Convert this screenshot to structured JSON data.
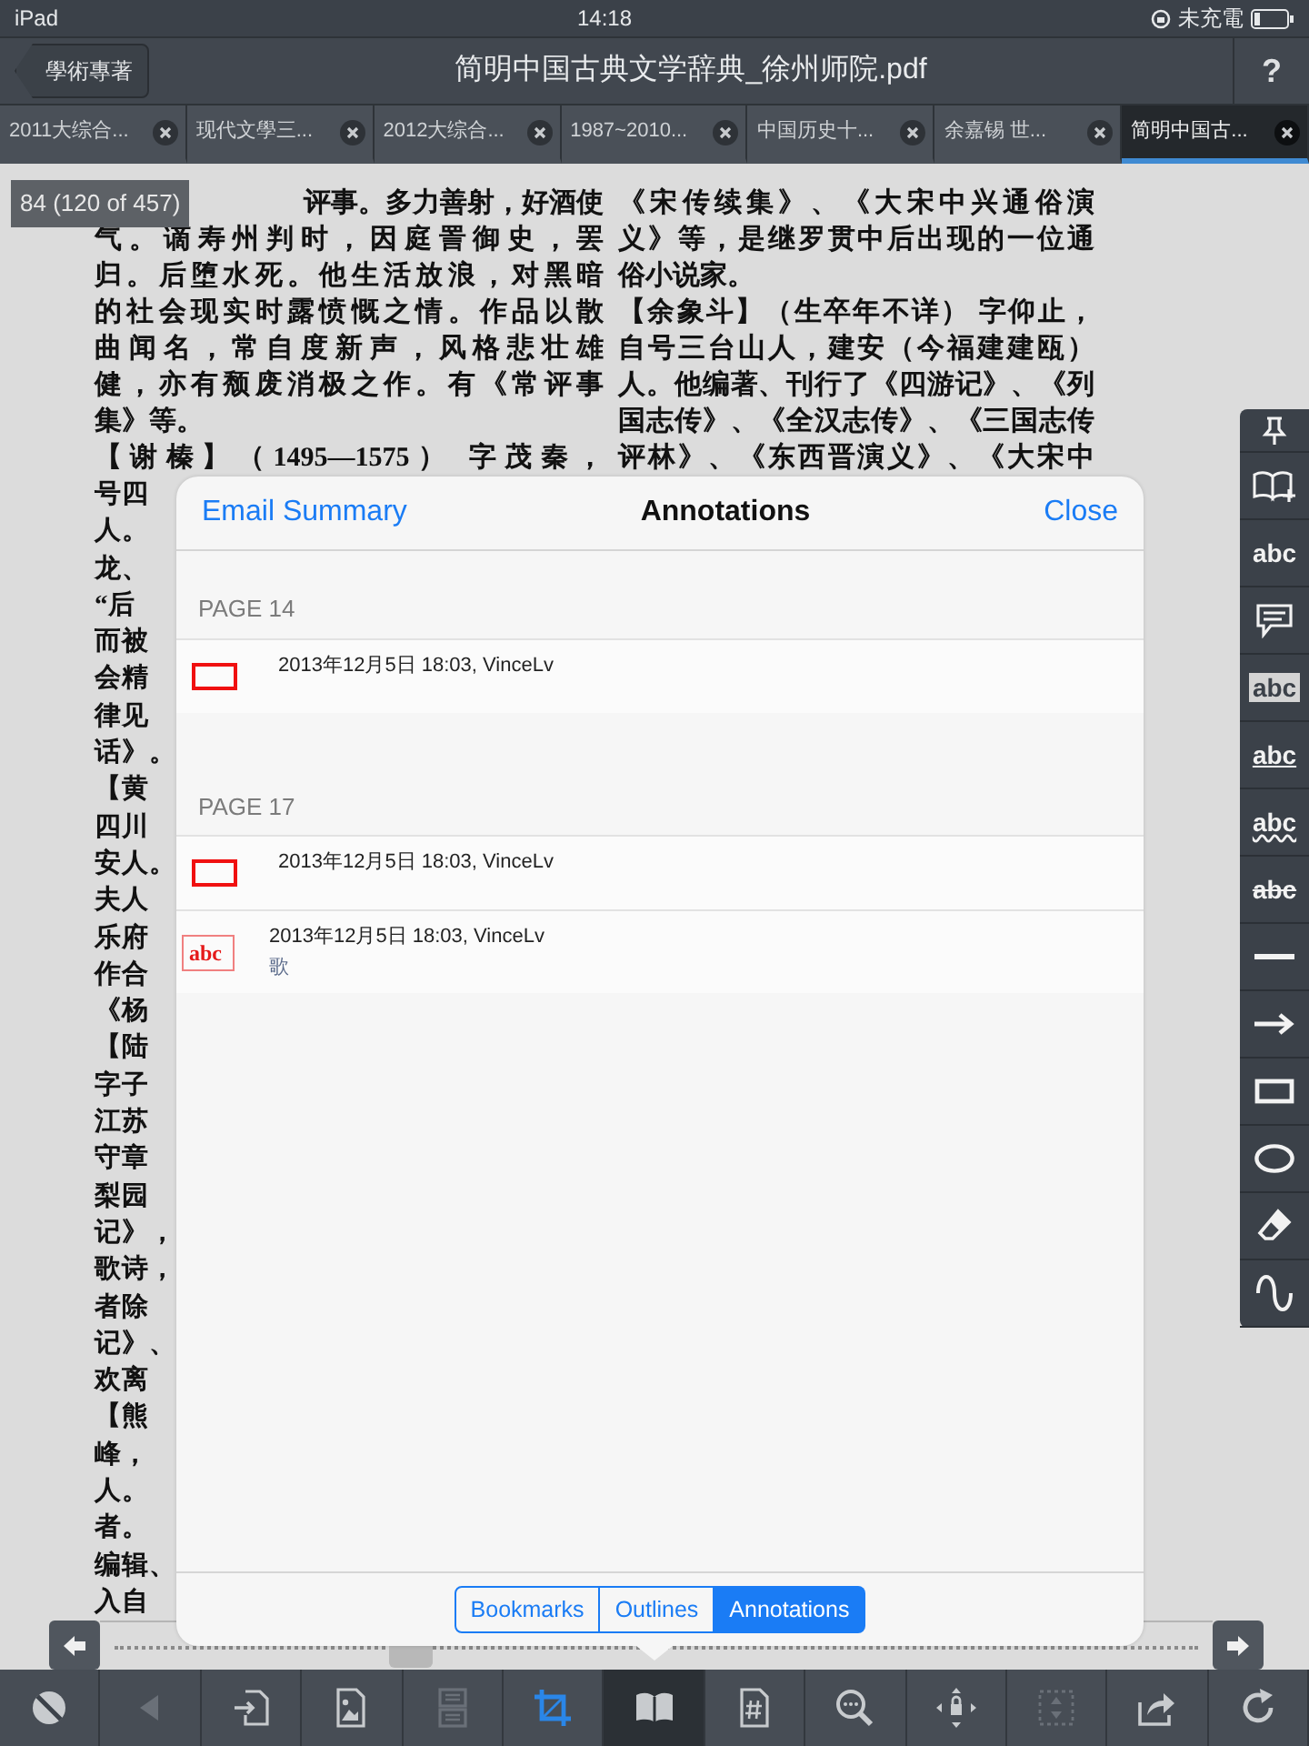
{
  "status_bar": {
    "device": "iPad",
    "time": "14:18",
    "charging": "未充電"
  },
  "nav_bar": {
    "back": "學術專著",
    "title": "简明中国古典文学辞典_徐州师院.pdf",
    "help": "?"
  },
  "tabs": [
    {
      "label": "2011大综合...",
      "selected": false
    },
    {
      "label": "现代文學三...",
      "selected": false
    },
    {
      "label": "2012大综合...",
      "selected": false
    },
    {
      "label": "1987~2010...",
      "selected": false
    },
    {
      "label": "中国历史十...",
      "selected": false
    },
    {
      "label": "余嘉锡 世...",
      "selected": false
    },
    {
      "label": "简明中国古...",
      "selected": true
    }
  ],
  "page_indicator": "84 (120 of 457)",
  "document": {
    "left_column": [
      {
        "kind": "tail",
        "text": "评事。多力善射，好酒使"
      },
      {
        "kind": "full",
        "text": "气。谪寿州判时，因庭詈御史，罢"
      },
      {
        "kind": "full",
        "text": "归。后堕水死。他生活放浪，对黑暗"
      },
      {
        "kind": "full",
        "text": "的社会现实时露愤慨之情。作品以散"
      },
      {
        "kind": "full",
        "text": "曲闻名，常自度新声，风格悲壮雄"
      },
      {
        "kind": "full",
        "text": "健，亦有颓废消极之作。有《常评事"
      },
      {
        "kind": "end",
        "text": "集》等。"
      },
      {
        "kind": "full",
        "text": "【谢榛】（1495—1575） 字茂秦，"
      }
    ],
    "right_column": [
      {
        "kind": "full",
        "text": "《宋传续集》、《大宋中兴通俗演"
      },
      {
        "kind": "full",
        "text": "义》等，是继罗贯中后出现的一位通"
      },
      {
        "kind": "end",
        "text": "俗小说家。"
      },
      {
        "kind": "full",
        "text": "【余象斗】（生卒年不详） 字仰止，"
      },
      {
        "kind": "full",
        "text": "自号三台山人，建安（今福建建瓯）"
      },
      {
        "kind": "full",
        "text": "人。他编著、刊行了《四游记》、《列"
      },
      {
        "kind": "full",
        "text": "国志传》、《全汉志传》、《三国志传"
      },
      {
        "kind": "full",
        "text": "评林》、《东西晋演义》、《大宋中"
      }
    ],
    "left_fragments": [
      "号四",
      "人。",
      "龙、",
      "“后",
      "而被",
      "会精",
      "律见",
      "话》。",
      "【黄",
      "四川",
      "安人。",
      "夫人",
      "乐府",
      "作合",
      "《杨",
      "【陆",
      "字子",
      "江苏",
      "守章",
      "梨园",
      "记》，",
      "歌诗，",
      "者除",
      "记》、",
      "欢离",
      "【熊",
      "峰，",
      "人。",
      "者。",
      "编辑、",
      "入自"
    ]
  },
  "scrubber": {
    "level": 0.27
  },
  "tools": [
    {
      "kind": "pin"
    },
    {
      "kind": "bookmark-add"
    },
    {
      "kind": "text-insert",
      "label": "abc"
    },
    {
      "kind": "note"
    },
    {
      "kind": "highlight",
      "label": "abc"
    },
    {
      "kind": "underline",
      "label": "abc"
    },
    {
      "kind": "squiggly",
      "label": "abc"
    },
    {
      "kind": "strikeout",
      "label": "abc"
    },
    {
      "kind": "line"
    },
    {
      "kind": "arrow"
    },
    {
      "kind": "rectangle"
    },
    {
      "kind": "ellipse"
    },
    {
      "kind": "eraser"
    },
    {
      "kind": "freehand"
    }
  ],
  "annotations_popover": {
    "left_button": "Email Summary",
    "title": "Annotations",
    "right_button": "Close",
    "sections": [
      {
        "heading": "PAGE 14",
        "items": [
          {
            "kind": "rectangle",
            "meta": "2013年12月5日 18:03, VinceLv"
          }
        ]
      },
      {
        "heading": "PAGE 17",
        "items": [
          {
            "kind": "rectangle",
            "meta": "2013年12月5日 18:03, VinceLv"
          },
          {
            "kind": "text-insert",
            "icon_label": "abc",
            "meta": "2013年12月5日 18:03, VinceLv",
            "note": "歌"
          }
        ]
      }
    ],
    "segments": [
      {
        "label": "Bookmarks",
        "selected": false
      },
      {
        "label": "Outlines",
        "selected": false
      },
      {
        "label": "Annotations",
        "selected": true
      }
    ]
  },
  "bottom_toolbar": [
    {
      "kind": "night",
      "selected": false,
      "disabled": false,
      "on": false
    },
    {
      "kind": "back",
      "selected": false,
      "disabled": true,
      "on": false
    },
    {
      "kind": "import",
      "selected": false,
      "disabled": false,
      "on": false
    },
    {
      "kind": "image-page",
      "selected": false,
      "disabled": false,
      "on": false
    },
    {
      "kind": "page-layout",
      "selected": false,
      "disabled": true,
      "on": false
    },
    {
      "kind": "crop",
      "selected": false,
      "disabled": false,
      "on": true
    },
    {
      "kind": "book",
      "selected": true,
      "disabled": false,
      "on": false
    },
    {
      "kind": "page-number",
      "selected": false,
      "disabled": false,
      "on": false
    },
    {
      "kind": "search",
      "selected": false,
      "disabled": false,
      "on": false
    },
    {
      "kind": "move",
      "selected": false,
      "disabled": false,
      "on": false
    },
    {
      "kind": "select-area",
      "selected": false,
      "disabled": true,
      "on": false
    },
    {
      "kind": "share",
      "selected": false,
      "disabled": false,
      "on": false
    },
    {
      "kind": "refresh",
      "selected": false,
      "disabled": false,
      "on": false
    }
  ]
}
